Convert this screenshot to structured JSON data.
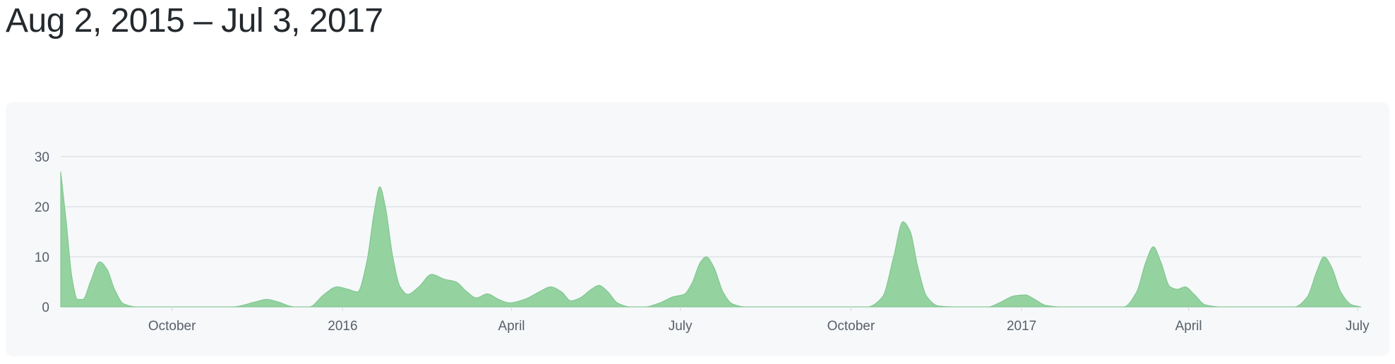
{
  "header": {
    "date_range": "Aug 2, 2015 – Jul 3, 2017"
  },
  "colors": {
    "area_fill": "#94d2a0",
    "area_stroke": "#7cc48b",
    "grid": "#dadde1",
    "axis_text": "#586069",
    "panel_bg": "#f6f8fa"
  },
  "chart_data": {
    "type": "area",
    "title": "",
    "xlabel": "",
    "ylabel": "",
    "x_range": [
      "2015-08-02",
      "2017-07-03"
    ],
    "ylim": [
      0,
      30
    ],
    "grid": true,
    "y_ticks": [
      {
        "value": 0,
        "label": "0"
      },
      {
        "value": 10,
        "label": "10"
      },
      {
        "value": 20,
        "label": "20"
      },
      {
        "value": 30,
        "label": "30"
      }
    ],
    "x_ticks": [
      {
        "date": "2015-10-01",
        "label": "October"
      },
      {
        "date": "2016-01-01",
        "label": "2016"
      },
      {
        "date": "2016-04-01",
        "label": "April"
      },
      {
        "date": "2016-07-01",
        "label": "July"
      },
      {
        "date": "2016-10-01",
        "label": "October"
      },
      {
        "date": "2017-01-01",
        "label": "2017"
      },
      {
        "date": "2017-04-01",
        "label": "April"
      },
      {
        "date": "2017-07-01",
        "label": "July"
      }
    ],
    "series": [
      {
        "points": [
          [
            "2015-08-02",
            27
          ],
          [
            "2015-08-05",
            17
          ],
          [
            "2015-08-08",
            6
          ],
          [
            "2015-08-11",
            1.5
          ],
          [
            "2015-08-14",
            1.5
          ],
          [
            "2015-08-18",
            5
          ],
          [
            "2015-08-23",
            9
          ],
          [
            "2015-08-27",
            7.5
          ],
          [
            "2015-08-31",
            3.5
          ],
          [
            "2015-09-05",
            0.6
          ],
          [
            "2015-09-12",
            0
          ],
          [
            "2015-11-03",
            0
          ],
          [
            "2015-11-15",
            1
          ],
          [
            "2015-11-21",
            1.5
          ],
          [
            "2015-11-27",
            1
          ],
          [
            "2015-12-06",
            0
          ],
          [
            "2015-12-14",
            0
          ],
          [
            "2015-12-22",
            2.5
          ],
          [
            "2015-12-29",
            4
          ],
          [
            "2016-01-04",
            3.5
          ],
          [
            "2016-01-09",
            3
          ],
          [
            "2016-01-14",
            9
          ],
          [
            "2016-01-18",
            19
          ],
          [
            "2016-01-21",
            24
          ],
          [
            "2016-01-24",
            20
          ],
          [
            "2016-01-28",
            10
          ],
          [
            "2016-02-01",
            4
          ],
          [
            "2016-02-05",
            2.5
          ],
          [
            "2016-02-11",
            4
          ],
          [
            "2016-02-18",
            6.5
          ],
          [
            "2016-02-25",
            5.5
          ],
          [
            "2016-03-02",
            5
          ],
          [
            "2016-03-08",
            3
          ],
          [
            "2016-03-13",
            1.8
          ],
          [
            "2016-03-19",
            2.6
          ],
          [
            "2016-03-25",
            1.5
          ],
          [
            "2016-03-31",
            0.8
          ],
          [
            "2016-04-08",
            1.5
          ],
          [
            "2016-04-16",
            3
          ],
          [
            "2016-04-22",
            4
          ],
          [
            "2016-04-28",
            3
          ],
          [
            "2016-05-03",
            1.2
          ],
          [
            "2016-05-08",
            1.8
          ],
          [
            "2016-05-14",
            3.5
          ],
          [
            "2016-05-18",
            4.3
          ],
          [
            "2016-05-23",
            3
          ],
          [
            "2016-05-28",
            0.8
          ],
          [
            "2016-06-04",
            0
          ],
          [
            "2016-06-12",
            0
          ],
          [
            "2016-06-20",
            0.8
          ],
          [
            "2016-06-27",
            2
          ],
          [
            "2016-07-03",
            2.5
          ],
          [
            "2016-07-07",
            4.5
          ],
          [
            "2016-07-12",
            9
          ],
          [
            "2016-07-15",
            10
          ],
          [
            "2016-07-19",
            8
          ],
          [
            "2016-07-24",
            3
          ],
          [
            "2016-07-29",
            0.6
          ],
          [
            "2016-08-05",
            0
          ],
          [
            "2016-10-10",
            0
          ],
          [
            "2016-10-18",
            2
          ],
          [
            "2016-10-24",
            10
          ],
          [
            "2016-10-29",
            17
          ],
          [
            "2016-11-02",
            15
          ],
          [
            "2016-11-06",
            8
          ],
          [
            "2016-11-11",
            2
          ],
          [
            "2016-11-17",
            0.2
          ],
          [
            "2016-11-25",
            0
          ],
          [
            "2016-12-14",
            0
          ],
          [
            "2016-12-21",
            1
          ],
          [
            "2016-12-28",
            2.2
          ],
          [
            "2017-01-03",
            2.4
          ],
          [
            "2017-01-08",
            1.5
          ],
          [
            "2017-01-14",
            0.3
          ],
          [
            "2017-01-22",
            0
          ],
          [
            "2017-02-25",
            0
          ],
          [
            "2017-03-04",
            3
          ],
          [
            "2017-03-09",
            9
          ],
          [
            "2017-03-13",
            12
          ],
          [
            "2017-03-17",
            9
          ],
          [
            "2017-03-22",
            4
          ],
          [
            "2017-03-26",
            3.5
          ],
          [
            "2017-03-30",
            4
          ],
          [
            "2017-04-04",
            2.5
          ],
          [
            "2017-04-10",
            0.4
          ],
          [
            "2017-04-18",
            0
          ],
          [
            "2017-05-28",
            0
          ],
          [
            "2017-06-04",
            2
          ],
          [
            "2017-06-09",
            7
          ],
          [
            "2017-06-13",
            10
          ],
          [
            "2017-06-17",
            8
          ],
          [
            "2017-06-22",
            3
          ],
          [
            "2017-06-28",
            0.4
          ],
          [
            "2017-07-03",
            0
          ]
        ]
      }
    ]
  }
}
